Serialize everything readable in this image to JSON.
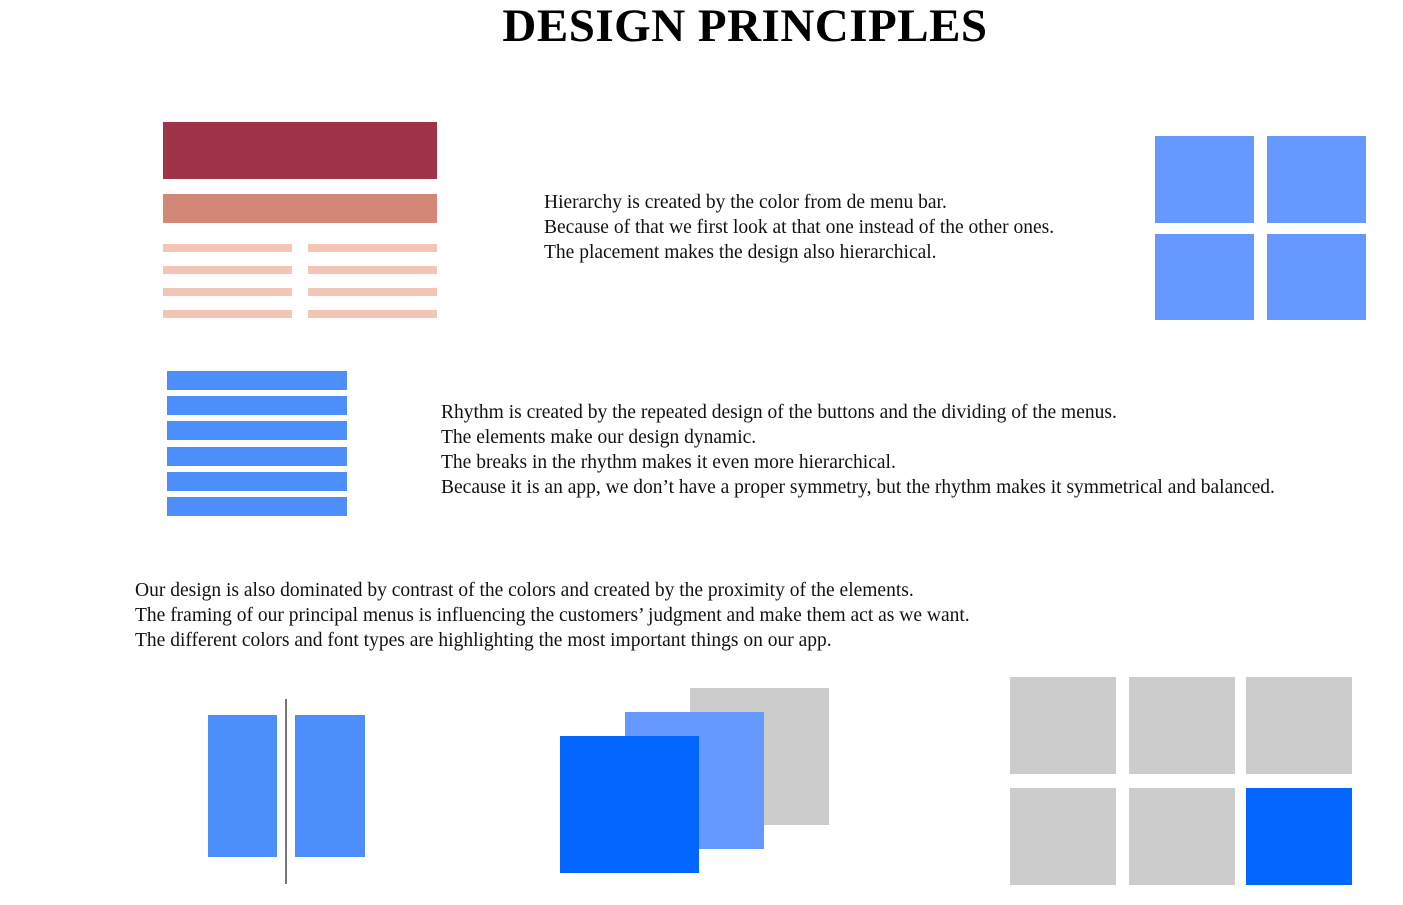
{
  "title": "DESIGN PRINCIPLES",
  "colors": {
    "hierarchy_bar_dark": "#a0324a",
    "hierarchy_bar_mid": "#d38877",
    "hierarchy_lines": "#f2c5b6",
    "tile_blue": "#6699ff",
    "rhythm_blue": "#4d8ffa",
    "strong_blue": "#0066ff",
    "grey": "#cccccc",
    "divider": "#777777"
  },
  "hierarchy": {
    "lines": [
      "Hierarchy is created by the color from de menu bar.",
      "Because of that we first look at that one instead of the other ones.",
      "The placement makes the design also hierarchical."
    ]
  },
  "rhythm": {
    "lines": [
      "Rhythm is created by the repeated design of the buttons and the dividing of the menus.",
      "The elements make our design dynamic.",
      "The breaks in the rhythm makes it even more hierarchical.",
      "Because it is an app, we don’t have a proper symmetry, but the rhythm makes it symmetrical and balanced."
    ]
  },
  "contrast": {
    "lines": [
      "Our design is also dominated by contrast of the colors and created by the proximity of the elements.",
      "The framing of our principal menus is influencing the customers’ judgment and make them act as we want.",
      "The different colors and font types are highlighting the most important things on our app."
    ]
  }
}
